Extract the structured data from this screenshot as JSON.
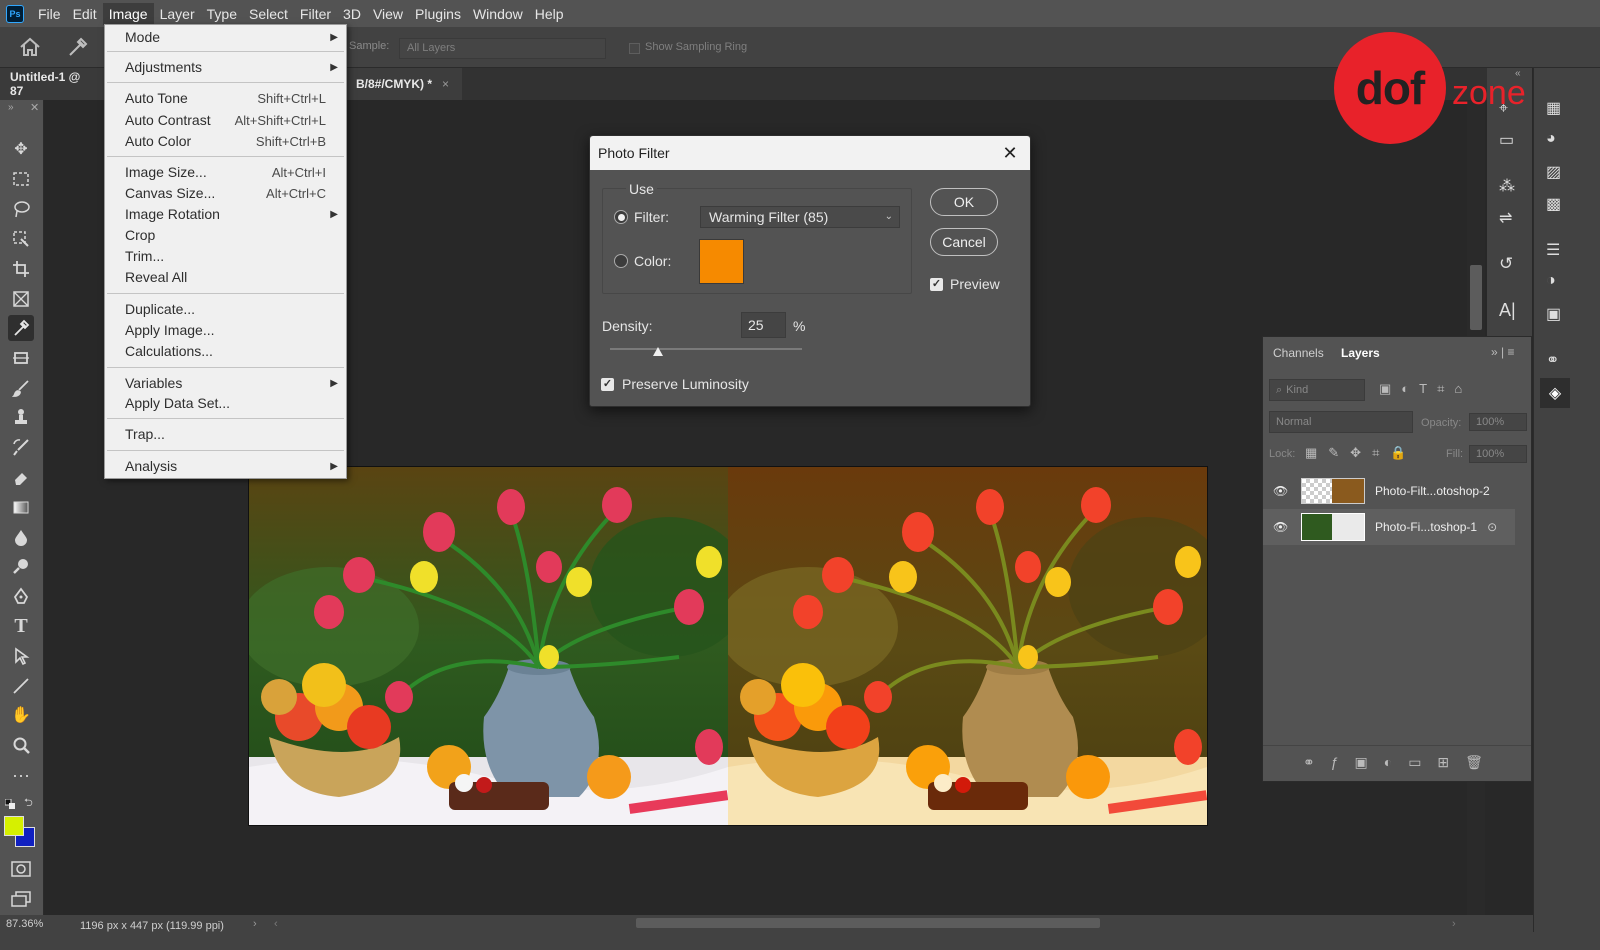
{
  "menubar": {
    "logo": "Ps",
    "items": [
      "File",
      "Edit",
      "Image",
      "Layer",
      "Type",
      "Select",
      "Filter",
      "3D",
      "View",
      "Plugins",
      "Window",
      "Help"
    ],
    "active": "Image"
  },
  "options_bar": {
    "sample_label": "Sample:",
    "sample_value": "All Layers",
    "sampling_ring": "Show Sampling Ring"
  },
  "tabs": {
    "doc1": "Untitled-1 @ 87",
    "doc2": "B/8#/CMYK) *",
    "close": "×"
  },
  "image_menu": {
    "mode": "Mode",
    "adjustments": "Adjustments",
    "auto_tone": "Auto Tone",
    "auto_tone_sc": "Shift+Ctrl+L",
    "auto_contrast": "Auto Contrast",
    "auto_contrast_sc": "Alt+Shift+Ctrl+L",
    "auto_color": "Auto Color",
    "auto_color_sc": "Shift+Ctrl+B",
    "image_size": "Image Size...",
    "image_size_sc": "Alt+Ctrl+I",
    "canvas_size": "Canvas Size...",
    "canvas_size_sc": "Alt+Ctrl+C",
    "image_rotation": "Image Rotation",
    "crop": "Crop",
    "trim": "Trim...",
    "reveal_all": "Reveal All",
    "duplicate": "Duplicate...",
    "apply_image": "Apply Image...",
    "calculations": "Calculations...",
    "variables": "Variables",
    "apply_data_set": "Apply Data Set...",
    "trap": "Trap...",
    "analysis": "Analysis"
  },
  "dialog": {
    "title": "Photo Filter",
    "use_label": "Use",
    "filter_label": "Filter:",
    "filter_value": "Warming Filter (85)",
    "color_label": "Color:",
    "color_swatch": "#f68a00",
    "density_label": "Density:",
    "density_value": "25",
    "density_unit": "%",
    "density_fraction": 0.25,
    "preserve_luminosity": "Preserve Luminosity",
    "ok": "OK",
    "cancel": "Cancel",
    "preview": "Preview"
  },
  "layers_panel": {
    "tab_channels": "Channels",
    "tab_layers": "Layers",
    "kind": "Kind",
    "blend_mode": "Normal",
    "opacity_label": "Opacity:",
    "opacity_value": "100%",
    "lock_label": "Lock:",
    "fill_label": "Fill:",
    "fill_value": "100%",
    "layers": [
      {
        "name": "Photo-Filt...otoshop-2"
      },
      {
        "name": "Photo-Fi...toshop-1"
      }
    ]
  },
  "status": {
    "zoom": "87.36%",
    "doc_info": "1196 px x 447 px (119.99 ppi)"
  },
  "watermark": {
    "dof": "dof",
    "zone": "zone"
  },
  "colors": {
    "foreground": "#d6f000",
    "background": "#1020c0",
    "accent": "#e8222a"
  }
}
